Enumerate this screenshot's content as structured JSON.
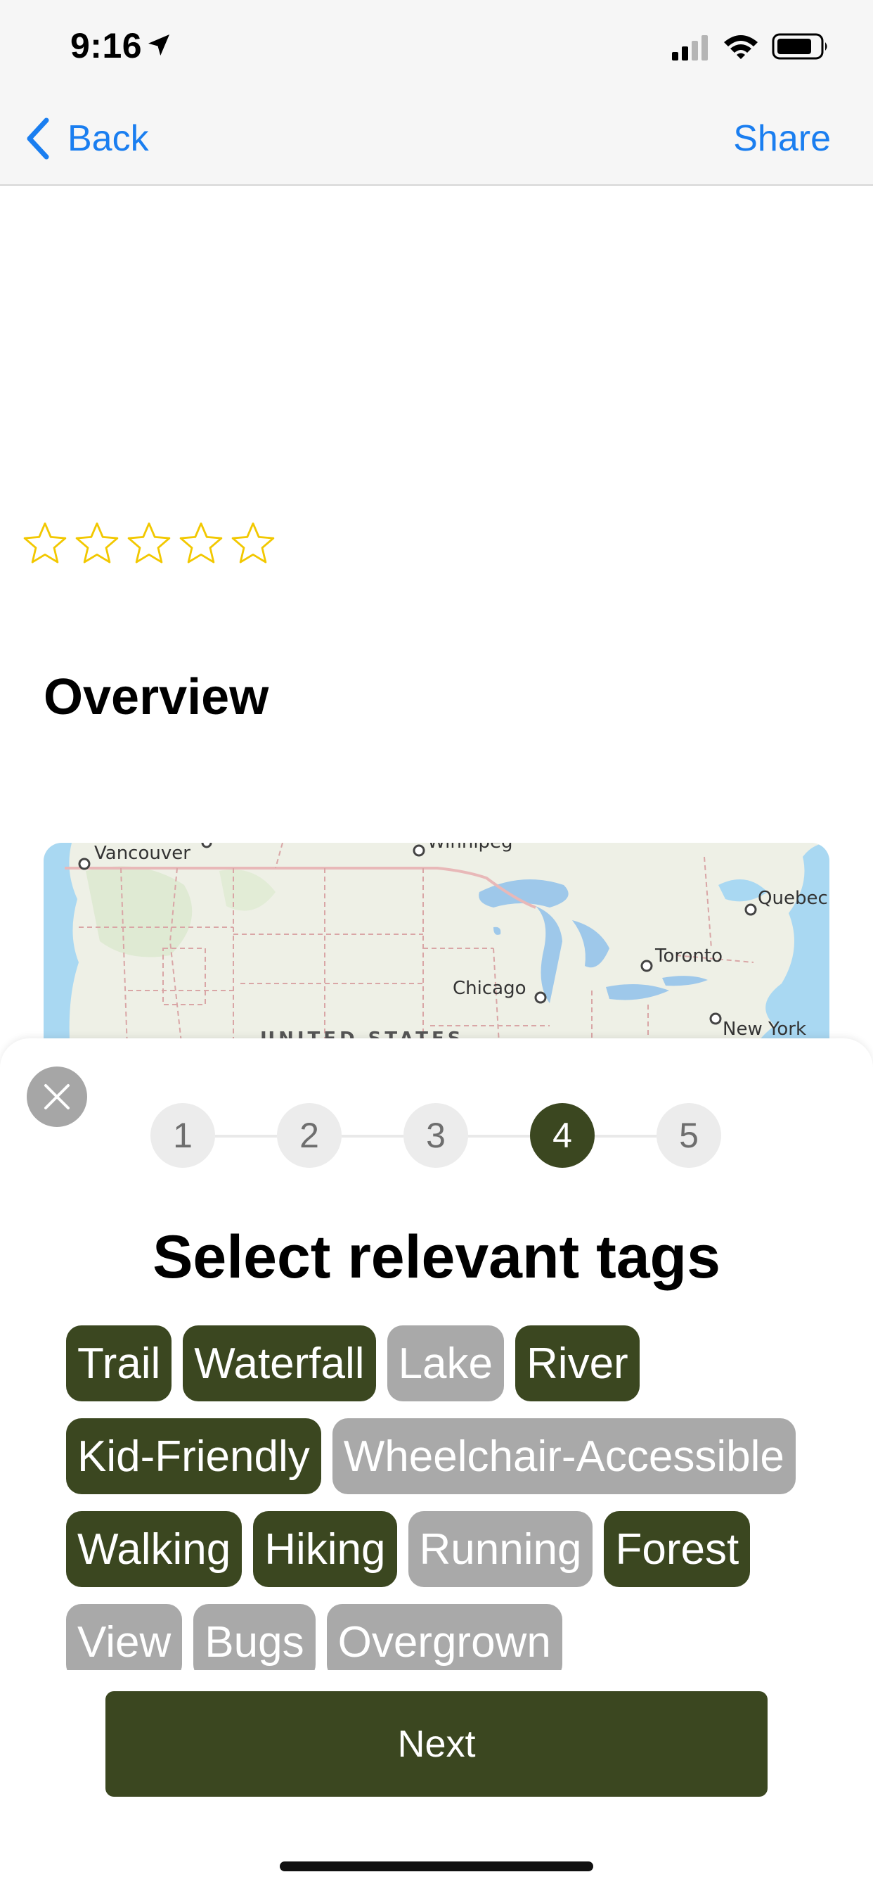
{
  "status_bar": {
    "time": "9:16",
    "icons": [
      "location-arrow-icon",
      "cellular-signal-icon",
      "wifi-icon",
      "battery-icon"
    ]
  },
  "nav": {
    "back_label": "Back",
    "share_label": "Share",
    "accent_color": "#1a7ef0"
  },
  "rating": {
    "max_stars": 5,
    "filled": 0,
    "star_color": "#f2c800"
  },
  "overview_title": "Overview",
  "map": {
    "labels": {
      "vancouver": "Vancouver",
      "winnipeg": "Winnipeg",
      "quebec": "Quebec",
      "toronto": "Toronto",
      "chicago": "Chicago",
      "new_york": "New York",
      "united_states": "UNITED STATES"
    }
  },
  "sheet": {
    "steps": [
      "1",
      "2",
      "3",
      "4",
      "5"
    ],
    "current_step": 4,
    "title": "Select relevant tags",
    "tag_rows": [
      [
        {
          "label": "Trail",
          "selected": true
        },
        {
          "label": "Waterfall",
          "selected": true
        },
        {
          "label": "Lake",
          "selected": false
        },
        {
          "label": "River",
          "selected": true
        }
      ],
      [
        {
          "label": "Kid-Friendly",
          "selected": true
        },
        {
          "label": "Wheelchair-Accessible",
          "selected": false
        }
      ],
      [
        {
          "label": "Walking",
          "selected": true
        },
        {
          "label": "Hiking",
          "selected": true
        },
        {
          "label": "Running",
          "selected": false
        },
        {
          "label": "Forest",
          "selected": true
        }
      ],
      [
        {
          "label": "View",
          "selected": false
        },
        {
          "label": "Bugs",
          "selected": false
        },
        {
          "label": "Overgrown",
          "selected": false
        }
      ]
    ],
    "next_label": "Next",
    "primary_color": "#3b4720",
    "unselected_color": "#a9a9a9"
  }
}
